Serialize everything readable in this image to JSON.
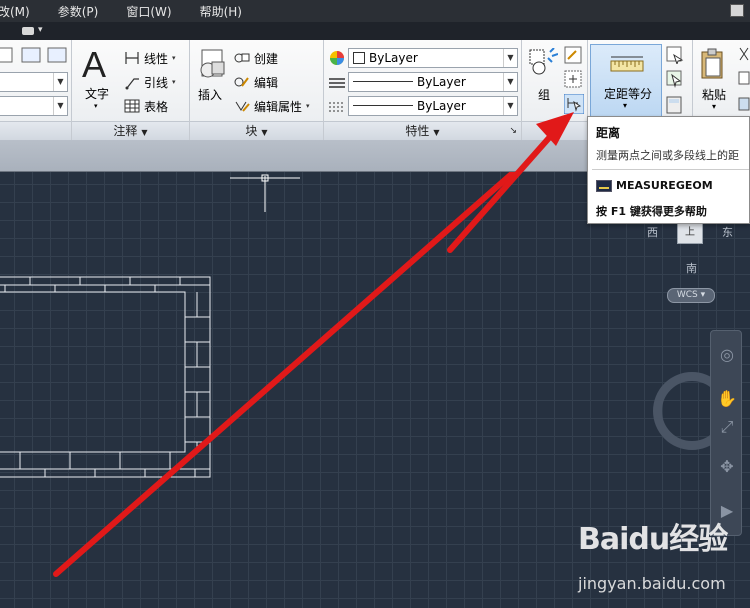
{
  "menu": {
    "items": [
      "改(M)",
      "参数(P)",
      "窗口(W)",
      "帮助(H)"
    ]
  },
  "ribbon": {
    "annotation": {
      "title": "注释",
      "text_label": "文字",
      "linear_label": "线性",
      "leader_label": "引线",
      "table_label": "表格"
    },
    "block": {
      "title": "块",
      "insert_label": "插入",
      "create_label": "创建",
      "edit_label": "编辑",
      "edit_attr_label": "编辑属性"
    },
    "properties": {
      "title": "特性",
      "color_value": "ByLayer",
      "linetype_value": "ByLayer",
      "lineweight_value": "ByLayer"
    },
    "groups": {
      "group_label": "组"
    },
    "utilities": {
      "measure_label": "定距等分"
    },
    "clipboard": {
      "paste_label": "粘贴"
    }
  },
  "tooltip": {
    "title": "距离",
    "description": "测量两点之间或多段线上的距",
    "command": "MEASUREGEOM",
    "help": "按 F1 键获得更多帮助"
  },
  "viewcube": {
    "west": "西",
    "east": "东",
    "south": "南",
    "top": "上",
    "wcs": "WCS"
  },
  "watermark": {
    "brand": "Baidu经验",
    "url": "jingyan.baidu.com"
  },
  "colors": {
    "canvas": "#263140",
    "arrow": "#e11919",
    "ribbon": "#f0f2f5"
  }
}
